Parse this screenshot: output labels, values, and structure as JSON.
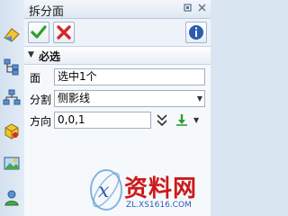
{
  "window": {
    "title": "拆分面"
  },
  "titlebar_icons": [
    "pin-icon",
    "close-icon"
  ],
  "toolbar": {
    "ok_icon": "checkmark-icon",
    "cancel_icon": "x-icon",
    "info_icon": "info-icon"
  },
  "section": {
    "title": "必选"
  },
  "fields": {
    "face": {
      "label": "面",
      "value": "选中1个"
    },
    "split": {
      "label": "分割",
      "value": "侧影线"
    },
    "direction": {
      "label": "方向",
      "value": "0,0,1"
    }
  },
  "watermark": {
    "brand": "资料网",
    "url": "ZL.XS1616.COM"
  },
  "colors": {
    "ok_green": "#2e9e2e",
    "cancel_red": "#d42a2a",
    "info_blue": "#2a5db0",
    "watermark_red": "#cc1a1a"
  }
}
